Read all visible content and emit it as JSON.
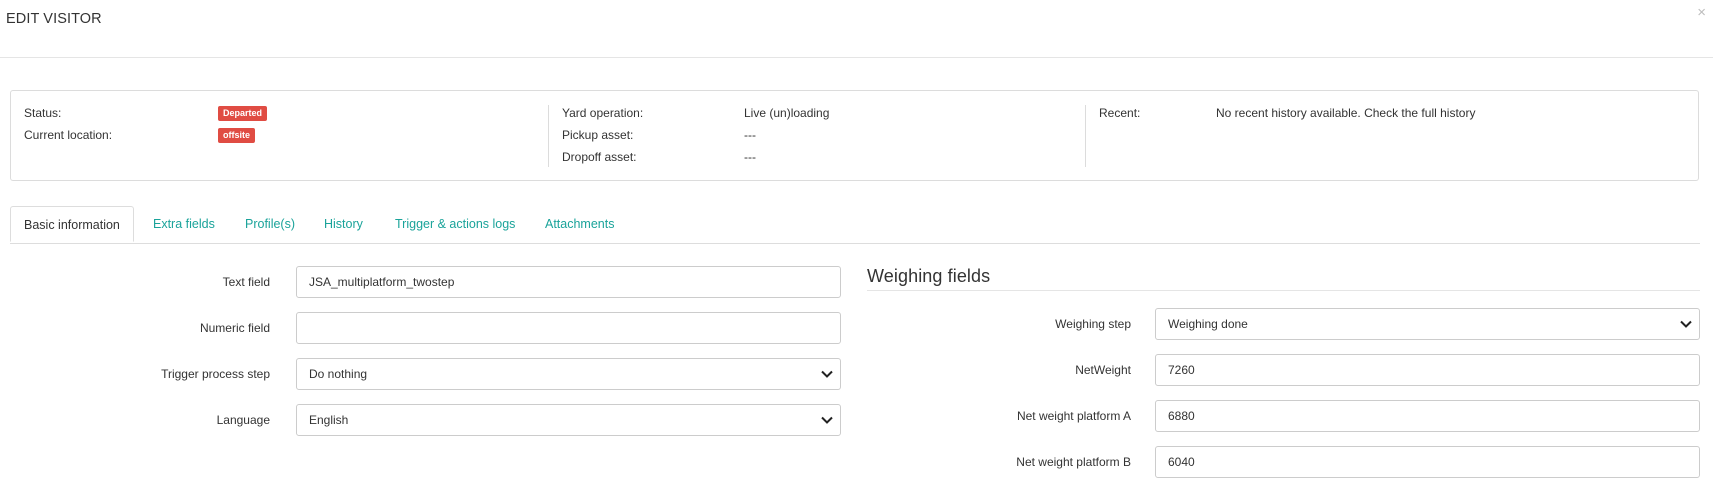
{
  "modal": {
    "title": "EDIT VISITOR",
    "close_symbol": "×"
  },
  "status_panel": {
    "col1": [
      {
        "label": "Status:",
        "badge": "Departed",
        "badge_color": "#e04c43"
      },
      {
        "label": "Current location:",
        "badge": "offsite",
        "badge_color": "#e04c43"
      }
    ],
    "col2": [
      {
        "label": "Yard operation:",
        "value": "Live (un)loading"
      },
      {
        "label": "Pickup asset:",
        "value": "---"
      },
      {
        "label": "Dropoff asset:",
        "value": "---"
      }
    ],
    "col3": [
      {
        "label": "Recent:",
        "value": "No recent history available. Check the full history"
      }
    ]
  },
  "tabs": [
    {
      "label": "Basic information",
      "active": true
    },
    {
      "label": "Extra fields"
    },
    {
      "label": "Profile(s)"
    },
    {
      "label": "History"
    },
    {
      "label": "Trigger & actions logs"
    },
    {
      "label": "Attachments"
    }
  ],
  "left_form": [
    {
      "label": "Text field",
      "value": "JSA_multiplatform_twostep",
      "type": "text"
    },
    {
      "label": "Numeric field",
      "value": "",
      "type": "text"
    },
    {
      "label": "Trigger process step",
      "value": "Do nothing",
      "type": "select"
    },
    {
      "label": "Language",
      "value": "English",
      "type": "select"
    }
  ],
  "weighing": {
    "title": "Weighing fields",
    "fields": [
      {
        "label": "Weighing step",
        "value": "Weighing done",
        "type": "select"
      },
      {
        "label": "NetWeight",
        "value": "7260",
        "type": "text"
      },
      {
        "label": "Net weight platform A",
        "value": "6880",
        "type": "text"
      },
      {
        "label": "Net weight platform B",
        "value": "6040",
        "type": "text"
      }
    ]
  },
  "colors": {
    "accent": "#1aa39a",
    "badge": "#e04c43",
    "border": "#dcdcdc"
  }
}
